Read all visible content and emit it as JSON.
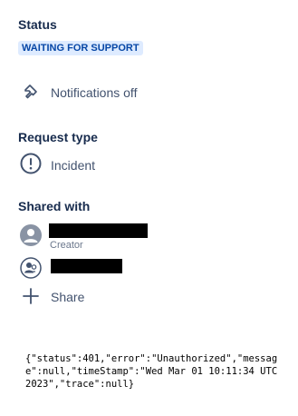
{
  "status": {
    "heading": "Status",
    "value": "WAITING FOR SUPPORT",
    "lozenge_bg": "#deebff",
    "lozenge_fg": "#0747a6"
  },
  "notifications": {
    "icon": "bell-off-icon",
    "label": "Notifications off"
  },
  "request_type": {
    "heading": "Request type",
    "icon": "exclamation-circle-icon",
    "label": "Incident"
  },
  "shared_with": {
    "heading": "Shared with",
    "creator_role": "Creator",
    "share_label": "Share"
  },
  "error_response": "{\"status\":401,\"error\":\"Unauthorized\",\"message\":null,\"timeStamp\":\"Wed Mar 01 10:11:34 UTC 2023\",\"trace\":null}"
}
